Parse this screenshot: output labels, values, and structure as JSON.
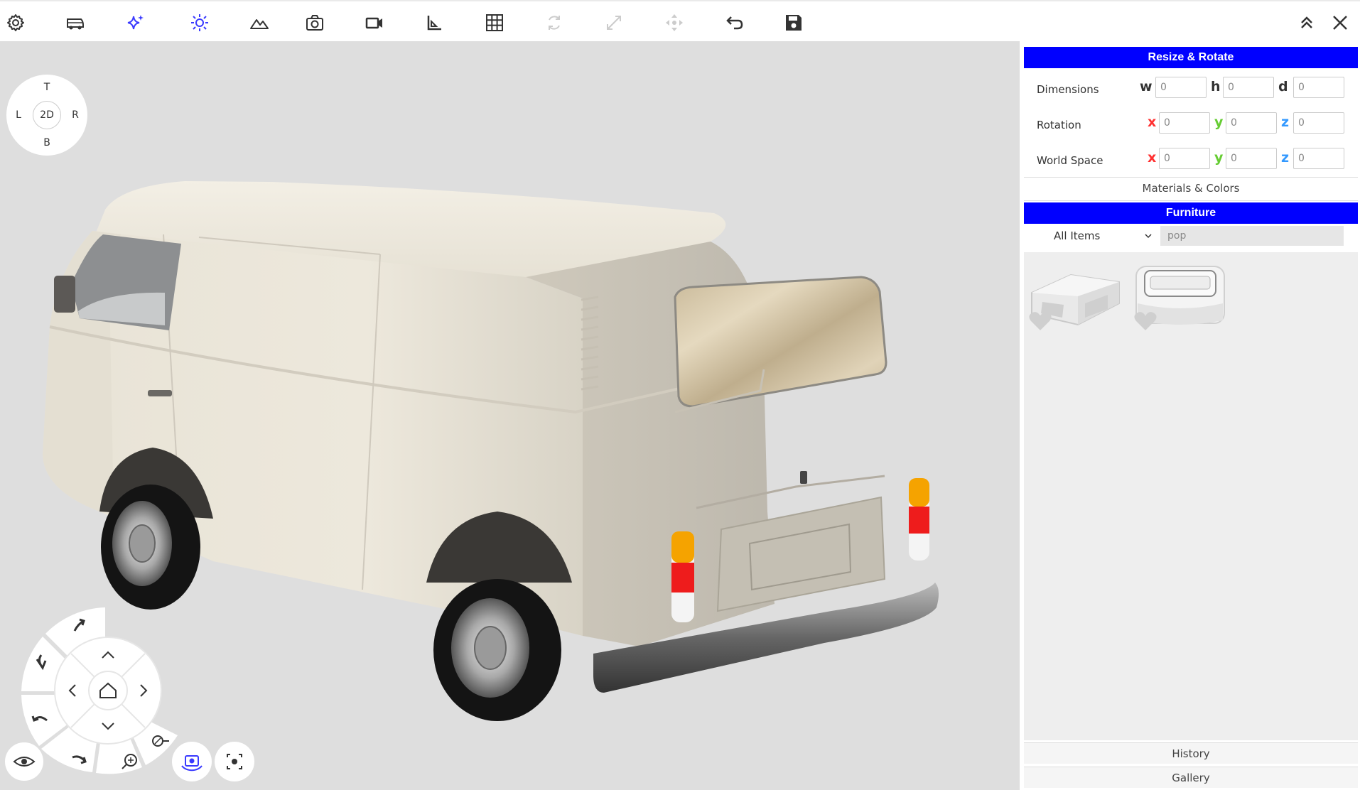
{
  "toolbar": {
    "icons": [
      "gear-icon",
      "van-icon",
      "sparkle-icon",
      "sun-icon",
      "terrain-icon",
      "camera-icon",
      "video-icon",
      "ruler-icon",
      "grid-icon",
      "rotate-icon",
      "resize-icon",
      "move-icon",
      "undo-icon",
      "save-icon",
      "collapse-icon",
      "close-icon"
    ],
    "accent_color": "#3a3aff",
    "disabled_color": "#cccccc"
  },
  "viewcube": {
    "top": "T",
    "left": "L",
    "center": "2D",
    "right": "R",
    "bottom": "B"
  },
  "panel": {
    "resize_title": "Resize & Rotate",
    "dimensions_label": "Dimensions",
    "rotation_label": "Rotation",
    "world_label": "World Space",
    "dim_axes": [
      "w",
      "h",
      "d"
    ],
    "xyz_axes": [
      "x",
      "y",
      "z"
    ],
    "dimensions": [
      "0",
      "0",
      "0"
    ],
    "rotation": [
      "0",
      "0",
      "0"
    ],
    "world": [
      "0",
      "0",
      "0"
    ],
    "materials_label": "Materials & Colors",
    "furniture_title": "Furniture",
    "filter_value": "All Items",
    "search_value": "pop",
    "history_label": "History",
    "gallery_label": "Gallery",
    "axis_colors": {
      "x": "#ff3030",
      "y": "#66cc33",
      "z": "#3399ff"
    },
    "header_color": "#0000ff"
  }
}
